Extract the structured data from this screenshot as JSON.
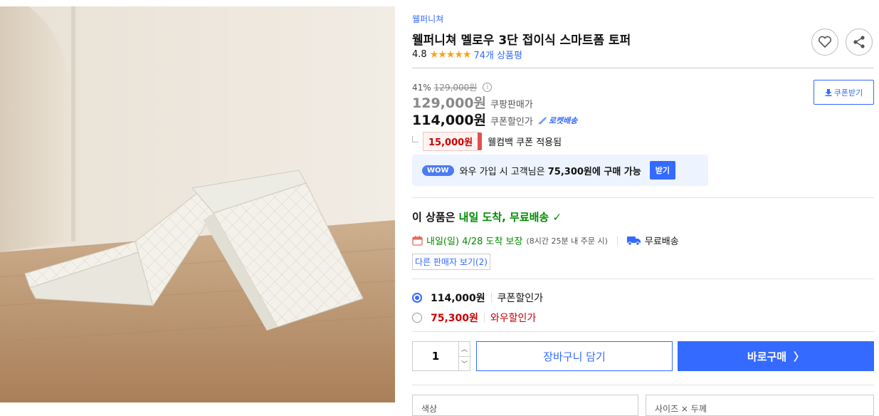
{
  "product": {
    "brand": "웰퍼니쳐",
    "title": "웰퍼니쳐 멜로우 3단 접이식 스마트폼 토퍼",
    "rating": "4.8",
    "stars": "★★★★★",
    "review_count": "74개 상품평"
  },
  "pricing": {
    "discount_rate": "41%",
    "original_price": "129,000원",
    "sale_price": "129,000원",
    "sale_label": "쿠팡판매가",
    "coupon_price": "114,000원",
    "coupon_label": "쿠폰할인가",
    "rocket_label": "로켓배송",
    "coupon_button": "쿠폰받기",
    "cashback_amount": "15,000원",
    "cashback_text": "웰컴백 쿠폰 적용됨"
  },
  "wow": {
    "badge": "WOW",
    "text_prefix": "와우 가입 시 고객님은",
    "text_bold": "75,300원에 구매 가능",
    "button": "받기"
  },
  "delivery": {
    "arrival_prefix": "이 상품은",
    "arrival_highlight": "내일 도착, 무료배송",
    "arrival_check": "✓",
    "date": "내일(일) 4/28 도착 보장",
    "note": "(8시간 25분 내 주문 시)",
    "free_shipping": "무료배송",
    "other_sellers": "다른 판매자 보기(2)"
  },
  "options": [
    {
      "price": "114,000원",
      "label": "쿠폰할인가",
      "selected": true
    },
    {
      "price": "75,300원",
      "label": "와우할인가",
      "selected": false
    }
  ],
  "purchase": {
    "quantity": "1",
    "cart_button": "장바구니 담기",
    "buy_button": "바로구매",
    "buy_arrow": "〉"
  },
  "selectors": {
    "color_label": "색상",
    "size_label": "사이즈 × 두께"
  },
  "icons": {
    "wishlist": "heart-icon",
    "share": "share-icon",
    "info": "info-icon",
    "calendar": "calendar-icon",
    "truck": "truck-icon",
    "download": "download-icon",
    "rocket": "rocket-icon"
  },
  "colors": {
    "accent": "#346aff",
    "green": "#008c00",
    "red": "#cc0000",
    "star": "#f8a21c"
  }
}
